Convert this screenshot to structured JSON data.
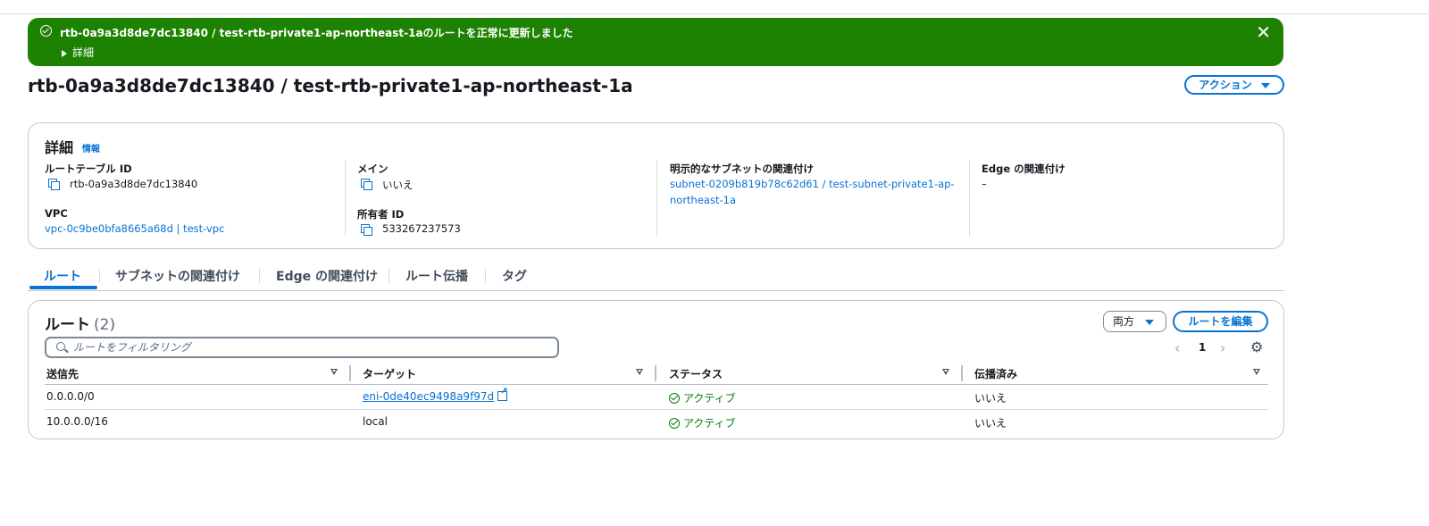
{
  "banner": {
    "message": "rtb-0a9a3d8de7dc13840 / test-rtb-private1-ap-northeast-1aのルートを正常に更新しました",
    "details_label": "詳細",
    "close_symbol": "✕",
    "color": "#1d8102"
  },
  "page": {
    "title": "rtb-0a9a3d8de7dc13840 / test-rtb-private1-ap-northeast-1a",
    "actions_label": "アクション"
  },
  "details": {
    "title": "詳細",
    "info_label": "情報",
    "route_table_id_label": "ルートテーブル ID",
    "route_table_id": "rtb-0a9a3d8de7dc13840",
    "vpc_label": "VPC",
    "vpc_value": "vpc-0c9be0bfa8665a68d | test-vpc",
    "main_label": "メイン",
    "main_value": "いいえ",
    "owner_label": "所有者 ID",
    "owner_value": "533267237573",
    "subnet_assoc_label": "明示的なサブネットの関連付け",
    "subnet_assoc_line1": "subnet-0209b819b78c62d61 / test-subnet-private1-ap-",
    "subnet_assoc_line2": "northeast-1a",
    "edge_label": "Edge の関連付け",
    "edge_value": "–"
  },
  "tabs": [
    {
      "label": "ルート",
      "active": true
    },
    {
      "label": "サブネットの関連付け",
      "active": false
    },
    {
      "label": "Edge の関連付け",
      "active": false
    },
    {
      "label": "ルート伝播",
      "active": false
    },
    {
      "label": "タグ",
      "active": false
    }
  ],
  "routes": {
    "title": "ルート",
    "count": "(2)",
    "filter_label": "両方",
    "edit_label": "ルートを編集",
    "search_placeholder": "ルートをフィルタリング",
    "page_number": "1",
    "prev_symbol": "‹",
    "next_symbol": "›",
    "settings_symbol": "⚙",
    "columns": [
      "送信先",
      "ターゲット",
      "ステータス",
      "伝播済み"
    ],
    "rows": [
      {
        "destination": "0.0.0.0/0",
        "target": "eni-0de40ec9498a9f97d",
        "target_is_link": true,
        "status": "アクティブ",
        "propagated": "いいえ"
      },
      {
        "destination": "10.0.0.0/16",
        "target": "local",
        "target_is_link": false,
        "status": "アクティブ",
        "propagated": "いいえ"
      }
    ]
  },
  "colors": {
    "accent": "#0972d3",
    "success": "#037f0c",
    "text": "#16191f"
  }
}
